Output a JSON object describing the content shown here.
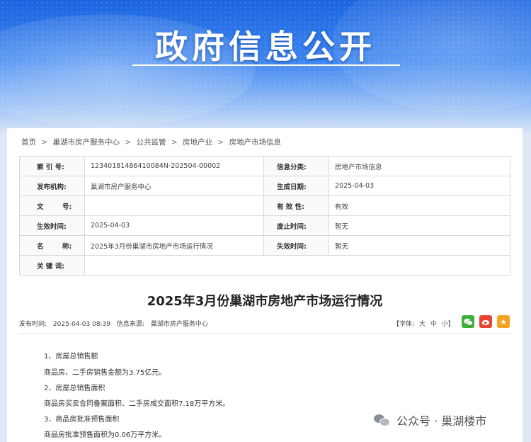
{
  "banner": {
    "title": "政府信息公开"
  },
  "breadcrumb": {
    "items": [
      "首页",
      "巢湖市房产服务中心",
      "公共监管",
      "房地产业",
      "房地产市场信息"
    ],
    "separator": ">"
  },
  "meta": {
    "index_label": "索 引 号:",
    "index_value": "12340181486410084N-202504-00002",
    "category_label": "信息分类:",
    "category_value": "房地产市场信息",
    "publisher_label": "发布机构:",
    "publisher_value": "巢湖市房产服务中心",
    "generated_label": "生成日期:",
    "generated_value": "2025-04-03",
    "docno_label": "文        号:",
    "docno_value": "",
    "validity_label": "有 效 性:",
    "validity_value": "有效",
    "effective_label": "生效时间:",
    "effective_value": "2025-04-03",
    "abolish_label": "废止时间:",
    "abolish_value": "暂无",
    "name_label": "名        称:",
    "name_value": "2025年3月份巢湖市房地产市场运行情况",
    "invalid_label": "失效时间:",
    "invalid_value": "暂无",
    "keywords_label": "关 键 词:",
    "keywords_value": ""
  },
  "article": {
    "title": "2025年3月份巢湖市房地产市场运行情况",
    "publish_time_label": "发布时间:",
    "publish_time": "2025-04-03 08:39",
    "source_label": "信息来源:",
    "source": "巢湖市房产服务中心",
    "font_label": "【字体:",
    "font_large": "大",
    "font_medium": "中",
    "font_small": "小】",
    "paragraphs": [
      "1、房屋总销售额",
      "商品房、二手房销售金额为3.75亿元。",
      "2、房屋总销售面积",
      "商品房买卖合同备案面积、二手房成交面积7.18万平方米。",
      "3、商品房批准预售面积",
      "商品房批准预售面积为0.06万平方米。"
    ]
  },
  "share": {
    "wechat_icon": "wechat-icon",
    "weibo_icon": "weibo-icon",
    "favorite_icon": "star-icon"
  },
  "watermark": {
    "text": "公众号 · 巢湖楼市"
  },
  "colors": {
    "banner": "#2f78e8",
    "wechat": "#3db03a",
    "weibo": "#e6462f",
    "favorite": "#f3a321"
  }
}
